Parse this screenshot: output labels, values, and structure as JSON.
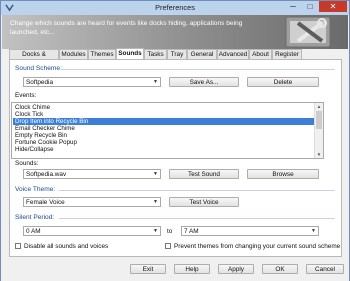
{
  "window": {
    "title": "Preferences",
    "minimize": "─",
    "maximize": "□",
    "close": "✕"
  },
  "banner": {
    "text": "Change which sounds are heard for events like docks hiding, applications being launched, etc..."
  },
  "tabs": [
    "Docks & Shelves",
    "Modules",
    "Themes",
    "Sounds",
    "Tasks",
    "Tray",
    "General",
    "Advanced",
    "About",
    "Register"
  ],
  "active_tab": "Sounds",
  "sound_scheme": {
    "section_label": "Sound Scheme:",
    "value": "Softpedia",
    "save_as": "Save As...",
    "delete": "Delete"
  },
  "events": {
    "label": "Events:",
    "items": [
      "Clock Chime",
      "Clock Tick",
      "Drop Item into Recycle Bin",
      "Email Checker Chime",
      "Empty Recycle Bin",
      "Fortune Cookie Popup",
      "Hide/Collapse"
    ],
    "selected": "Drop Item into Recycle Bin"
  },
  "sounds": {
    "label": "Sounds:",
    "value": "Softpedia.wav",
    "test": "Test Sound",
    "browse": "Browse"
  },
  "voice_theme": {
    "section_label": "Voice Theme:",
    "value": "Female Voice",
    "test": "Test Voice"
  },
  "silent_period": {
    "section_label": "Silent Period:",
    "from": "0 AM",
    "to_label": "to",
    "to": "7 AM"
  },
  "options": {
    "disable_all": "Disable all sounds and voices",
    "prevent_themes": "Prevent themes from changing your current sound scheme"
  },
  "footer": {
    "exit": "Exit",
    "help": "Help",
    "apply": "Apply",
    "ok": "OK",
    "cancel": "Cancel"
  }
}
